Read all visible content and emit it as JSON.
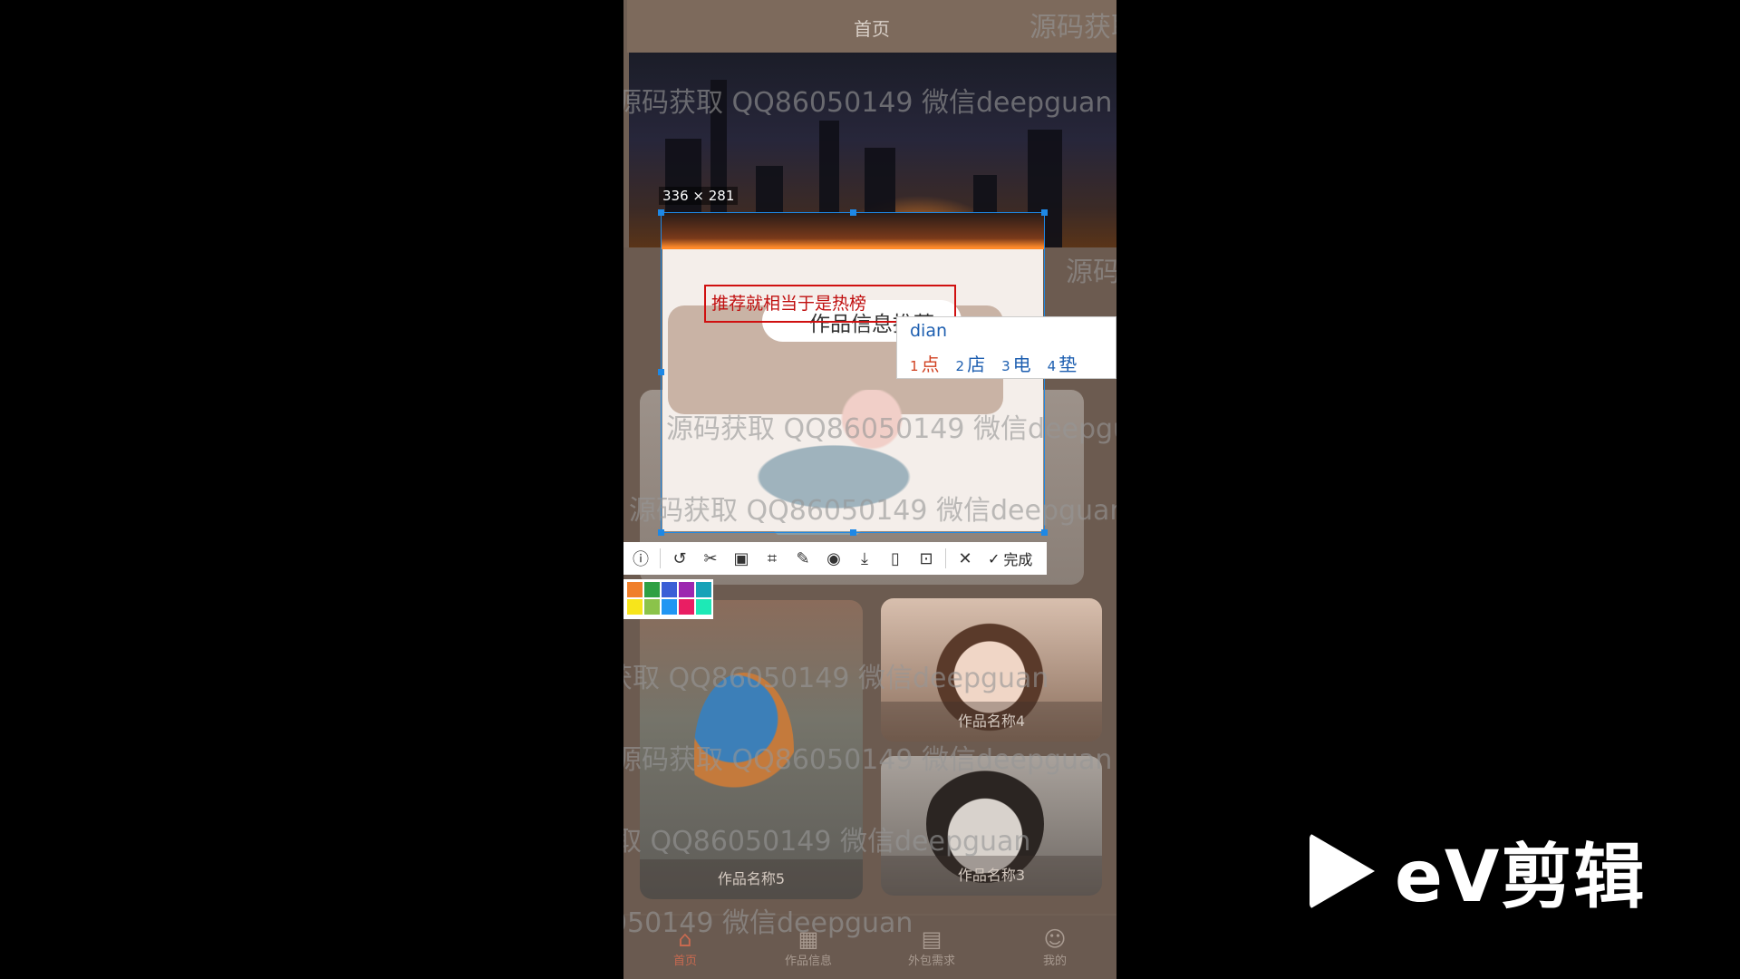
{
  "navbar": {
    "title": "首页"
  },
  "works": [
    {
      "title": "作品名称4"
    },
    {
      "title": "作品名称5"
    },
    {
      "title": "作品名称3"
    }
  ],
  "tabbar": [
    {
      "label": "首页",
      "icon": "home-icon",
      "active": true
    },
    {
      "label": "作品信息",
      "icon": "grid-icon",
      "active": false
    },
    {
      "label": "外包需求",
      "icon": "calendar-icon",
      "active": false
    },
    {
      "label": "我的",
      "icon": "user-icon",
      "active": false
    }
  ],
  "screenshot_tool": {
    "size_label": "336 × 281",
    "annotation_text": "推荐就相当于是热榜",
    "overlapped_heading": "作品信息推荐",
    "toolbar": {
      "tools": [
        "info-icon",
        "undo-icon",
        "crop-icon",
        "ocr-icon",
        "scan-icon",
        "pin-icon",
        "record-icon",
        "download-icon",
        "phone-icon",
        "bookmark-icon"
      ],
      "close_icon": "close-icon",
      "done_label": "完成"
    },
    "palette_colors": [
      "#f07f2a",
      "#2ea043",
      "#3b5fd6",
      "#9c27b0",
      "#17a2b8",
      "#f7e51b",
      "#8bc34a",
      "#2196f3",
      "#e91e63",
      "#1de9b6"
    ]
  },
  "ime": {
    "input": "dian",
    "candidates": [
      {
        "index": "1",
        "text": "点"
      },
      {
        "index": "2",
        "text": "店"
      },
      {
        "index": "3",
        "text": "电"
      },
      {
        "index": "4",
        "text": "垫"
      }
    ]
  },
  "watermark": {
    "line": "源码获取 QQ86050149 微信deepguan"
  },
  "brand": {
    "logo_text": "eV剪辑"
  }
}
